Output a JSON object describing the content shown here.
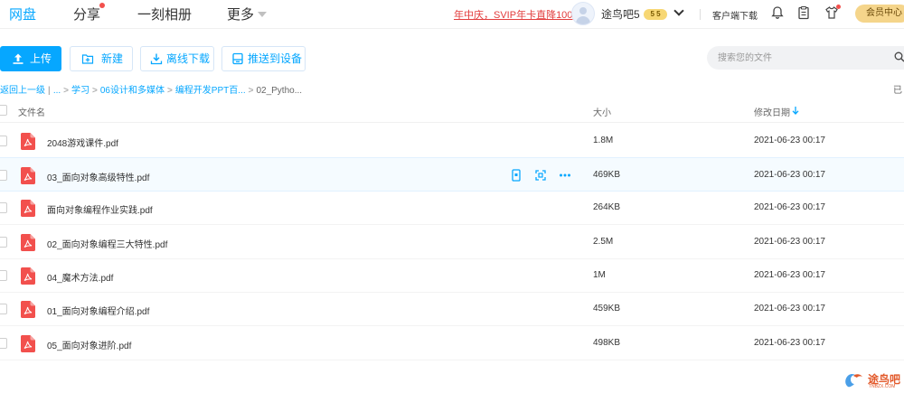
{
  "nav": {
    "items": [
      "网盘",
      "分享",
      "一刻相册",
      "更多"
    ],
    "active_color": "#06a7ff"
  },
  "header": {
    "promo": "年中庆，SVIP年卡直降100",
    "username": "途鸟吧5",
    "vip_badge": "5 5",
    "client_download": "客户端下载",
    "member_center": "会员中心"
  },
  "toolbar": {
    "upload": "上传",
    "new": "新建",
    "offline_download": "离线下载",
    "push_to_device": "推送到设备",
    "search_placeholder": "搜索您的文件"
  },
  "breadcrumb": {
    "back": "返回上一级",
    "ellipsis": "...",
    "items": [
      "学习",
      "06设计和多媒体",
      "编程开发PPT百..."
    ],
    "current": "02_Pytho...",
    "loaded": "已"
  },
  "table": {
    "headers": {
      "name": "文件名",
      "size": "大小",
      "modified": "修改日期"
    },
    "rows": [
      {
        "name": "2048游戏课件.pdf",
        "size": "1.8M",
        "modified": "2021-06-23 00:17"
      },
      {
        "name": "03_面向对象高级特性.pdf",
        "size": "469KB",
        "modified": "2021-06-23 00:17"
      },
      {
        "name": "面向对象编程作业实践.pdf",
        "size": "264KB",
        "modified": "2021-06-23 00:17"
      },
      {
        "name": "02_面向对象编程三大特性.pdf",
        "size": "2.5M",
        "modified": "2021-06-23 00:17"
      },
      {
        "name": "04_魔术方法.pdf",
        "size": "1M",
        "modified": "2021-06-23 00:17"
      },
      {
        "name": "01_面向对象编程介绍.pdf",
        "size": "459KB",
        "modified": "2021-06-23 00:17"
      },
      {
        "name": "05_面向对象进阶.pdf",
        "size": "498KB",
        "modified": "2021-06-23 00:17"
      }
    ]
  },
  "watermark": {
    "text": "途鸟吧",
    "sub": "TNBZX.COM"
  },
  "colors": {
    "accent": "#06a7ff",
    "pdf_red": "#f2504d",
    "promo_red": "#e23c3c",
    "member_gold": "#f5d58b"
  }
}
